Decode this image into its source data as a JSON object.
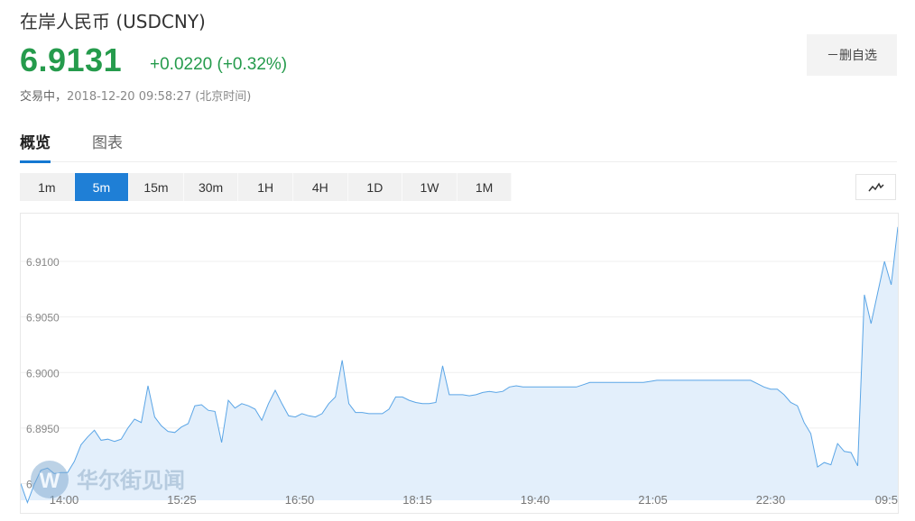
{
  "instrument": {
    "title": "在岸人民币 (USDCNY)"
  },
  "quote": {
    "price": "6.9131",
    "change": "+0.0220 (+0.32%)",
    "status": "交易中，",
    "timestamp": "2018-12-20 09:58:27 (北京时间)",
    "color_up": "#259b4c"
  },
  "actions": {
    "remove_watch": "－删自选"
  },
  "tabs": [
    {
      "label": "概览",
      "active": true
    },
    {
      "label": "图表",
      "active": false
    }
  ],
  "periods": [
    {
      "label": "1m",
      "active": false
    },
    {
      "label": "5m",
      "active": true
    },
    {
      "label": "15m",
      "active": false
    },
    {
      "label": "30m",
      "active": false
    },
    {
      "label": "1H",
      "active": false
    },
    {
      "label": "4H",
      "active": false
    },
    {
      "label": "1D",
      "active": false
    },
    {
      "label": "1W",
      "active": false
    },
    {
      "label": "1M",
      "active": false
    }
  ],
  "chart_type_icon": "line-chart-icon",
  "watermark": "华尔街见闻",
  "chart_data": {
    "type": "area",
    "title": "",
    "xlabel": "",
    "ylabel": "",
    "x_tick_labels": [
      "14:00",
      "15:25",
      "16:50",
      "18:15",
      "19:40",
      "21:05",
      "22:30",
      "09:5"
    ],
    "y_tick_labels": [
      "6.8900",
      "6.8950",
      "6.9000",
      "6.9050",
      "6.9100"
    ],
    "ylim": [
      6.8885,
      6.9143
    ],
    "grid": true,
    "line_color": "#5aa5e6",
    "fill_color": "#e3effb",
    "series": [
      {
        "values": [
          6.89,
          6.8883,
          6.8899,
          6.8912,
          6.8914,
          6.8909,
          6.891,
          6.891,
          6.892,
          6.8935,
          6.8942,
          6.8948,
          6.8939,
          6.894,
          6.8938,
          6.894,
          6.895,
          6.8958,
          6.8955,
          6.8988,
          6.896,
          6.8952,
          6.8947,
          6.8946,
          6.8951,
          6.8954,
          6.897,
          6.8971,
          6.8966,
          6.8965,
          6.8937,
          6.8975,
          6.8968,
          6.8972,
          6.897,
          6.8967,
          6.8957,
          6.8972,
          6.8984,
          6.8972,
          6.8961,
          6.896,
          6.8963,
          6.8961,
          6.896,
          6.8963,
          6.8972,
          6.8978,
          6.9011,
          6.8972,
          6.8964,
          6.8964,
          6.8963,
          6.8963,
          6.8963,
          6.8967,
          6.8978,
          6.8978,
          6.8975,
          6.8973,
          6.8972,
          6.8972,
          6.8973,
          6.9006,
          6.898,
          6.898,
          6.898,
          6.8979,
          6.898,
          6.8982,
          6.8983,
          6.8982,
          6.8983,
          6.8987,
          6.8988,
          6.8987,
          6.8987,
          6.8987,
          6.8987,
          6.8987,
          6.8987,
          6.8987,
          6.8987,
          6.8987,
          6.8989,
          6.8991,
          6.8991,
          6.8991,
          6.8991,
          6.8991,
          6.8991,
          6.8991,
          6.8991,
          6.8991,
          6.8992,
          6.8993,
          6.8993,
          6.8993,
          6.8993,
          6.8993,
          6.8993,
          6.8993,
          6.8993,
          6.8993,
          6.8993,
          6.8993,
          6.8993,
          6.8993,
          6.8993,
          6.8993,
          6.899,
          6.8987,
          6.8985,
          6.8985,
          6.898,
          6.8973,
          6.897,
          6.8955,
          6.8945,
          6.8915,
          6.8919,
          6.8917,
          6.8936,
          6.8929,
          6.8928,
          6.8916,
          6.907,
          6.9044,
          6.9072,
          6.91,
          6.9079,
          6.9131
        ]
      }
    ]
  }
}
